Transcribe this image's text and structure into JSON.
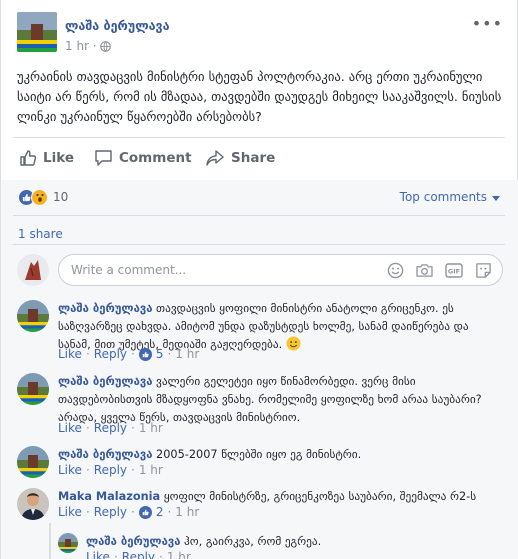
{
  "post": {
    "author": "ლაშა ბერულავა",
    "time": "1 hr",
    "more": "•••",
    "text": "უკრაინის თავდაცვის მინისტრი სტეფან პოლტორაკია. არც ერთი უკრაინული საიტი არ წერს, რომ ის მზადაა, თავდებში დაუდგეს მიხეილ სააკაშვილს. ნიუსის ლინკი უკრაინულ წყაროებში არსებობს?"
  },
  "actions": {
    "like": "Like",
    "comment": "Comment",
    "share": "Share"
  },
  "stats": {
    "reaction_count": "10",
    "top_comments": "Top comments",
    "shares": "1 share"
  },
  "compose": {
    "placeholder": "Write a comment..."
  },
  "comments": [
    {
      "author": "ლაშა ბერულავა",
      "text": "თავდაცვის ყოფილი მინისტრი ანატოლი გრიცენკო. ეს საზღვარზეც დახვდა. ამიტომ უნდა დაზუსტდეს ხოლმე, სანამ დაიწერება და სანამ, მით უმეტეს, მედიაში გაჟღერდება.",
      "like": "Like",
      "reply": "Reply",
      "likes": "5",
      "time": "1 hr"
    },
    {
      "author": "ლაშა ბერულავა",
      "text": "ვალერი გელეტეი იყო წინამორბედი. ვერც მისი თავდებობისთვის მზადყოფნა ვნახე. რომელიმე ყოფილზე ხომ არაა საუბარი? არადა, ყველა წერს, თავდაცვის მინისტრიო.",
      "like": "Like",
      "reply": "Reply",
      "time": "1 hr"
    },
    {
      "author": "ლაშა ბერულავა",
      "text": "2005-2007 წლებში იყო ეგ მინისტრი.",
      "like": "Like",
      "reply": "Reply",
      "time": "1 hr"
    },
    {
      "author": "Maka Malazonia",
      "text": "ყოფილ მინისტრზე, გრიცენკოზეა საუბარი, შეემალა რ2-ს",
      "like": "Like",
      "reply": "Reply",
      "likes": "2",
      "time": "1 hr"
    }
  ],
  "reply": {
    "author": "ლაშა ბერულავა",
    "text": "ჰო, გაირკვა, რომ ეგრეა.",
    "like": "Like",
    "reply": "Reply",
    "time": "1 hr"
  },
  "colors": {
    "link": "#365899",
    "accent": "#4267b2",
    "muted": "#90949c",
    "wow": "#f7b125"
  }
}
